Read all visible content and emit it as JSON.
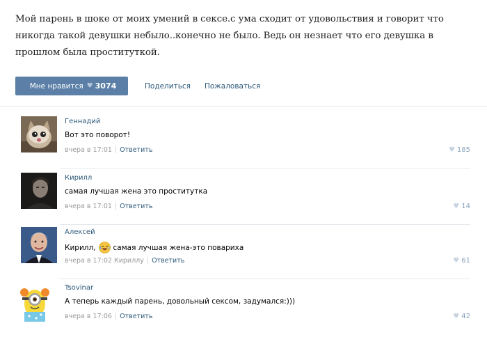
{
  "post": {
    "text": "Мой парень в шоке от моих умений в сексе.с ума сходит от удовольствия и говорит что никогда такой девушки небыло..конечно не было. Ведь он незнает что его девушка в прошлом была проституткой."
  },
  "actions": {
    "like_label": "Мне нравится",
    "like_count": "3074",
    "share_label": "Поделиться",
    "report_label": "Пожаловаться"
  },
  "comments": [
    {
      "name": "Геннадий",
      "text": "Вот это поворот!",
      "time": "вчера в 17:01",
      "reply_to": "",
      "reply_label": "Ответить",
      "likes": "185"
    },
    {
      "name": "Кирилл",
      "text": "самая лучшая жена это проститутка",
      "time": "вчера в 17:01",
      "reply_to": "",
      "reply_label": "Ответить",
      "likes": "14"
    },
    {
      "name": "Алексей",
      "text_before": "Кирилл,",
      "text_after": "самая лучшая жена-это повариха",
      "time": "вчера в 17:02",
      "reply_to": "Кириллу",
      "reply_label": "Ответить",
      "likes": "61"
    },
    {
      "name": "Tsovinar",
      "text": "А теперь каждый парень, довольный сексом, задумался:)))",
      "time": "вчера в 17:06",
      "reply_to": "",
      "reply_label": "Ответить",
      "likes": "42"
    }
  ],
  "colors": {
    "accent": "#5b7fa6",
    "link": "#2b587a",
    "meta": "#999999"
  }
}
